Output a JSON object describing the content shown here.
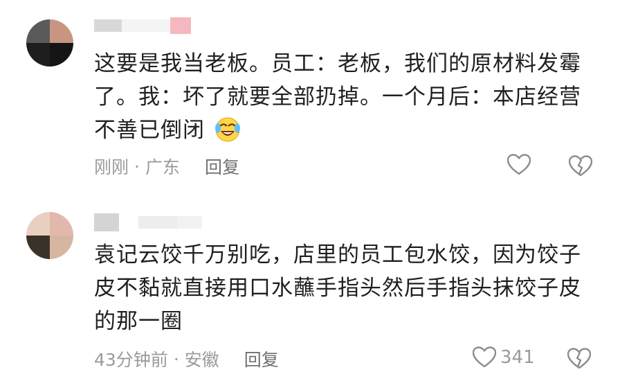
{
  "comments": [
    {
      "text": "这要是我当老板。员工：老板，我们的原材料发霉了。我：坏了就要全部扔掉。一个月后：本店经营不善已倒闭",
      "emoji": "crying-laughing-face-emoji",
      "time": "刚刚",
      "separator": "·",
      "location": "广东",
      "reply_label": "回复",
      "like_count": "",
      "avatar_colors": [
        "#5a5a5a",
        "#c89580",
        "#1e1e1e",
        "#151515"
      ]
    },
    {
      "text": "袁记云饺千万别吃，店里的员工包水饺，因为饺子皮不黏就直接用口水蘸手指头然后手指头抹饺子皮的那一圈",
      "time": "43分钟前",
      "separator": "·",
      "location": "安徽",
      "reply_label": "回复",
      "like_count": "341",
      "avatar_colors": [
        "#e8cfc0",
        "#e2b8ad",
        "#3a3228",
        "#d6b6a0"
      ]
    }
  ],
  "colors": {
    "text": "#1f1f1f",
    "meta": "#9a9a9a",
    "icon": "#8c8c8c",
    "accent_pink": "#f5b8be"
  }
}
